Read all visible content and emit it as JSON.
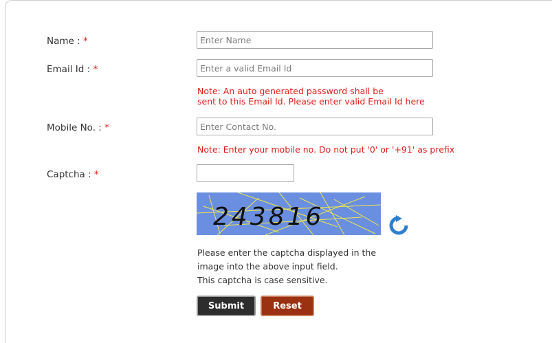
{
  "form": {
    "name": {
      "label": "Name :",
      "required": "*",
      "placeholder": "Enter Name",
      "value": ""
    },
    "email": {
      "label": "Email Id :",
      "required": "*",
      "placeholder": "Enter a valid Email Id",
      "value": "",
      "note_line1": "Note: An auto generated password shall be",
      "note_line2": "sent to this Email Id. Please enter valid Email Id here"
    },
    "mobile": {
      "label": "Mobile No. :",
      "required": "*",
      "placeholder": "Enter Contact No.",
      "value": "",
      "note": "Note: Enter your mobile no. Do not put '0' or '+91' as prefix"
    },
    "captcha": {
      "label": "Captcha :",
      "required": "*",
      "value": "",
      "image_text": "243816",
      "refresh_icon": "refresh-icon",
      "help_line1": "Please enter the captcha displayed in the",
      "help_line2": "image into the above input field.",
      "help_line3": "This captcha is case sensitive."
    }
  },
  "buttons": {
    "submit": "Submit",
    "reset": "Reset"
  },
  "colors": {
    "required": "#e31b1b",
    "note": "#e31b1b",
    "submit_bg": "#2d2d2d",
    "reset_bg": "#9a3212",
    "captcha_bg": "#6a8fe0",
    "captcha_lines": "#f2e84a",
    "refresh_icon": "#2f7fd0"
  }
}
